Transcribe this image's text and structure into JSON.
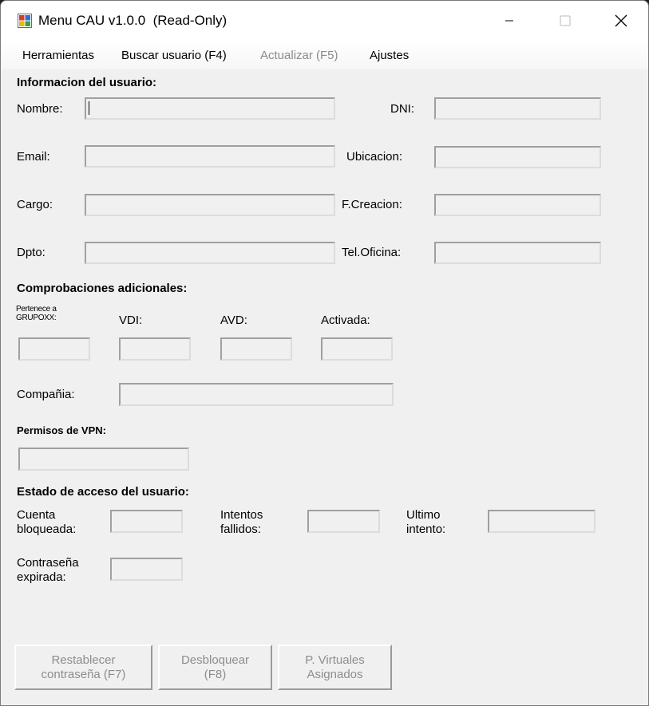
{
  "window": {
    "title": "Menu CAU v1.0.0  (Read-Only)",
    "controls": [
      "minimize-icon",
      "maximize-icon",
      "close-icon"
    ]
  },
  "menu": [
    {
      "label": "Herramientas",
      "enabled": true
    },
    {
      "label": "Buscar usuario (F4)",
      "enabled": true
    },
    {
      "label": "Actualizar (F5)",
      "enabled": false
    },
    {
      "label": "Ajustes",
      "enabled": true
    }
  ],
  "user_info": {
    "heading": "Informacion del usuario:",
    "nombre": {
      "label": "Nombre:",
      "value": ""
    },
    "dni": {
      "label": "DNI:",
      "value": ""
    },
    "email": {
      "label": "Email:",
      "value": ""
    },
    "ubicacion": {
      "label": "Ubicacion:",
      "value": ""
    },
    "cargo": {
      "label": "Cargo:",
      "value": ""
    },
    "fcreacion": {
      "label": "F.Creacion:",
      "value": ""
    },
    "dpto": {
      "label": "Dpto:",
      "value": ""
    },
    "teloficina": {
      "label": "Tel.Oficina:",
      "value": ""
    }
  },
  "checks": {
    "heading": "Comprobaciones adicionales:",
    "grupo": {
      "label": "Pertenece a\nGRUPOXX:",
      "value": ""
    },
    "vdi": {
      "label": "VDI:",
      "value": ""
    },
    "avd": {
      "label": "AVD:",
      "value": ""
    },
    "activada": {
      "label": "Activada:",
      "value": ""
    },
    "compania": {
      "label": "Compañia:",
      "value": ""
    },
    "vpn": {
      "label": "Permisos de VPN:",
      "value": ""
    }
  },
  "access": {
    "heading": "Estado de acceso del usuario:",
    "bloqueada": {
      "label": "Cuenta\nbloqueada:",
      "value": ""
    },
    "intentos": {
      "label": "Intentos\nfallidos:",
      "value": ""
    },
    "ultimo": {
      "label": "Ultimo\nintento:",
      "value": ""
    },
    "expirada": {
      "label": "Contraseña\nexpirada:",
      "value": ""
    }
  },
  "buttons": {
    "reset": {
      "label": "Restablecer\ncontraseña (F7)",
      "enabled": false
    },
    "unlock": {
      "label": "Desbloquear\n(F8)",
      "enabled": false
    },
    "pvirtual": {
      "label": "P. Virtuales\nAsignados",
      "enabled": false
    }
  },
  "colors": {
    "window_bg": "#f0f0f0",
    "disabled_text": "#8d8d8d",
    "titlebar_bg": "#ffffff"
  }
}
